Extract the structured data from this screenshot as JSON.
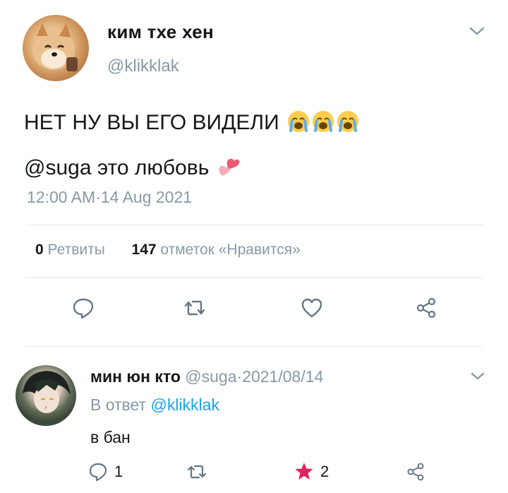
{
  "tweet": {
    "display_name": "ким тхе хен",
    "handle": "@klikklak",
    "text_line1": "НЕТ НУ ВЫ ЕГО ВИДЕЛИ",
    "text_line1_emoji": "😭😭😭",
    "mention": "@suga",
    "text_line2": " это любовь",
    "text_line2_emoji": "💕",
    "time": "12:00 AM",
    "date": "14 Aug 2021",
    "retweets_count": "0",
    "retweets_label": "Ретвиты",
    "likes_count": "147",
    "likes_label": "отметок «Нравится»"
  },
  "actions": [
    {
      "icon": "reply-icon"
    },
    {
      "icon": "retweet-icon"
    },
    {
      "icon": "heart-icon"
    },
    {
      "icon": "share-icon"
    }
  ],
  "reply": {
    "display_name": "мин юн кто",
    "handle": "@suga",
    "date": "2021/08/14",
    "reply_prefix": "В ответ",
    "reply_to": "@klikklak",
    "text": "в бан",
    "reply_count": "1",
    "like_count": "2"
  },
  "colors": {
    "text": "#14171a",
    "muted": "#8899a6",
    "link": "#1da1f2",
    "divider": "#e1e8ed",
    "star": "#e0245e"
  }
}
